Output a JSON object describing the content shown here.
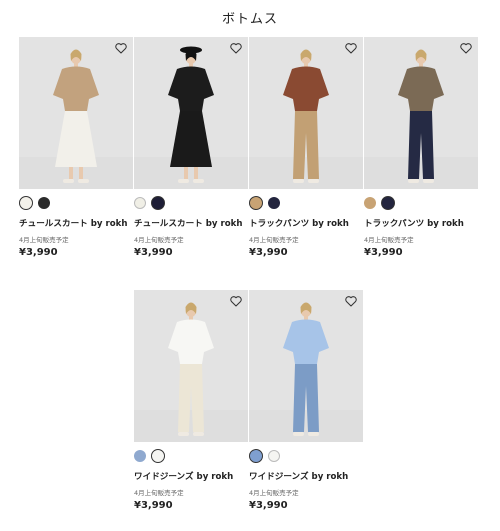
{
  "section": {
    "title": "ボトムス"
  },
  "products": [
    {
      "name": "チュールスカート by rokh",
      "note": "4月上旬販売予定",
      "price": "¥3,990",
      "top_color": "#c2a27e",
      "bottom_color": "#f2f0ea",
      "bottom_style": "skirt",
      "hat": false,
      "swatches": [
        {
          "color": "#f3f1ea",
          "selected": true
        },
        {
          "color": "#2b2b2b",
          "selected": false
        }
      ]
    },
    {
      "name": "チュールスカート by rokh",
      "note": "4月上旬販売予定",
      "price": "¥3,990",
      "top_color": "#1c1c1c",
      "bottom_color": "#1a1a1a",
      "bottom_style": "skirt",
      "hat": true,
      "swatches": [
        {
          "color": "#f0efe6",
          "selected": false
        },
        {
          "color": "#1e1e36",
          "selected": true
        }
      ]
    },
    {
      "name": "トラックパンツ by rokh",
      "note": "4月上旬販売予定",
      "price": "¥3,990",
      "top_color": "#8a4a32",
      "bottom_color": "#c2a074",
      "bottom_style": "pants",
      "hat": false,
      "swatches": [
        {
          "color": "#c8a374",
          "selected": true
        },
        {
          "color": "#23253e",
          "selected": false
        }
      ]
    },
    {
      "name": "トラックパンツ by rokh",
      "note": "4月上旬販売予定",
      "price": "¥3,990",
      "top_color": "#7b6a55",
      "bottom_color": "#252a44",
      "bottom_style": "pants",
      "hat": false,
      "swatches": [
        {
          "color": "#c8a374",
          "selected": false
        },
        {
          "color": "#23253e",
          "selected": true
        }
      ]
    },
    {
      "name": "ワイドジーンズ by rokh",
      "note": "4月上旬販売予定",
      "price": "¥3,990",
      "top_color": "#f7f7f4",
      "bottom_color": "#ece6d6",
      "bottom_style": "pants",
      "hat": false,
      "swatches": [
        {
          "color": "#8fa9cf",
          "selected": false
        },
        {
          "color": "#f5f5f2",
          "selected": true
        }
      ]
    },
    {
      "name": "ワイドジーンズ by rokh",
      "note": "4月上旬販売予定",
      "price": "¥3,990",
      "top_color": "#a7c4e8",
      "bottom_color": "#7c9cc6",
      "bottom_style": "pants",
      "hat": false,
      "swatches": [
        {
          "color": "#7f9fd0",
          "selected": true
        },
        {
          "color": "#f5f5f2",
          "selected": false
        }
      ]
    }
  ]
}
